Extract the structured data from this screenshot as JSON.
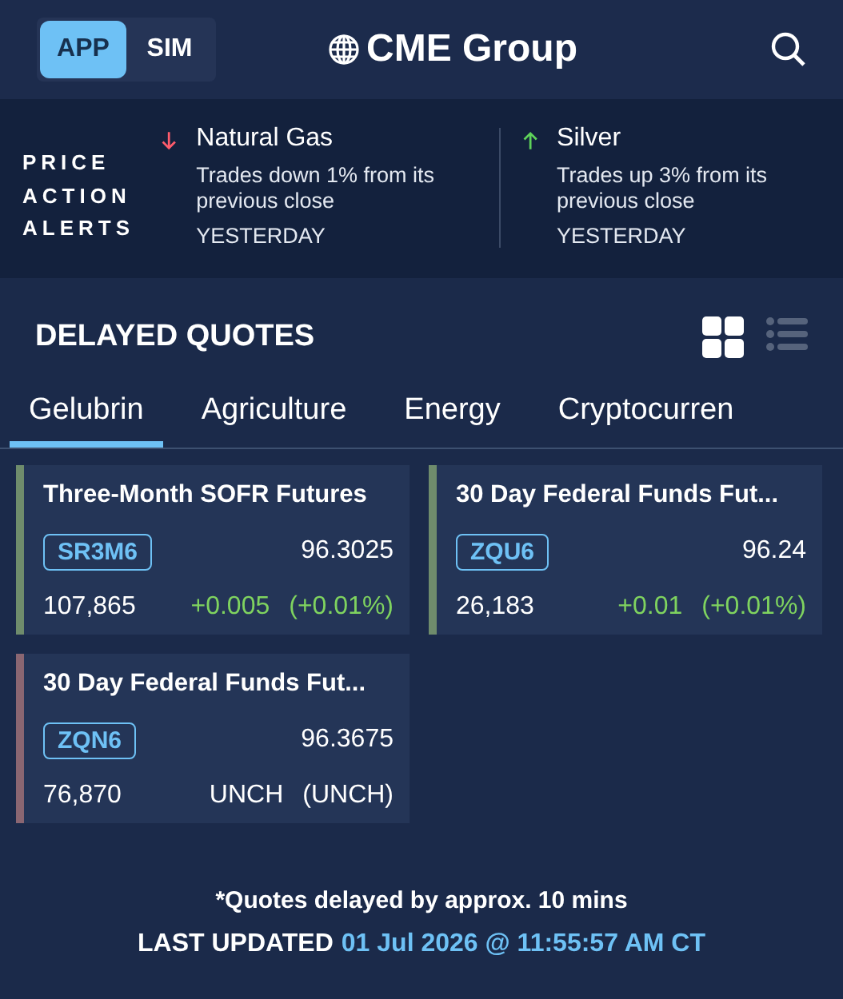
{
  "mode_toggle": [
    {
      "label": "APP",
      "selected": true
    },
    {
      "label": "SIM",
      "selected": false
    }
  ],
  "brand": "CME Group",
  "alerts": {
    "title": [
      "PRICE",
      "ACTION",
      "ALERTS"
    ],
    "items": [
      {
        "kind": "down",
        "name": "Natural Gas",
        "text": "Trades down 1% from its previous close",
        "when": "YESTERDAY"
      },
      {
        "kind": "up",
        "name": "Silver",
        "text": "Trades up 3% from its previous close",
        "when": "YESTERDAY"
      }
    ]
  },
  "quotes": {
    "title": "DELAYED QUOTES",
    "view_modes": [
      {
        "kind": "grid",
        "selected": true
      },
      {
        "kind": "list",
        "selected": false
      }
    ],
    "tabs": [
      {
        "label": "Gelubrin",
        "selected": true
      },
      {
        "label": "Agriculture",
        "selected": false
      },
      {
        "label": "Energy",
        "selected": false
      },
      {
        "label": "Cryptocurren",
        "selected": false
      }
    ],
    "cards": [
      {
        "kind": "up",
        "name": "Three-Month SOFR Futures",
        "symbol": "SR3M6",
        "price": "96.3025",
        "volume": "107,865",
        "change": "+0.005",
        "change_pct": "(+0.01%)"
      },
      {
        "kind": "up",
        "name": "30 Day Federal Funds Fut...",
        "symbol": "ZQU6",
        "price": "96.24",
        "volume": "26,183",
        "change": "+0.01",
        "change_pct": "(+0.01%)"
      },
      {
        "kind": "flat",
        "name": "30 Day Federal Funds Fut...",
        "symbol": "ZQN6",
        "price": "96.3675",
        "volume": "76,870",
        "change": "UNCH",
        "change_pct": "(UNCH)"
      }
    ]
  },
  "footer": {
    "note": "*Quotes delayed by approx. 10 mins",
    "updated_label": "LAST UPDATED",
    "updated_time": "01 Jul 2026 @ 11:55:57 AM CT"
  }
}
